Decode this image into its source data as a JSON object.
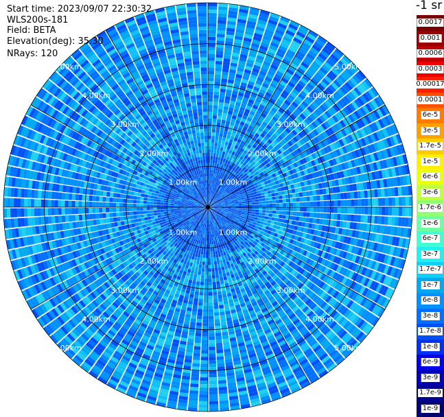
{
  "info": {
    "start_time": "Start time: 2023/09/07 22:30:32",
    "scan_name": "WLS200s-181",
    "field": "Field: BETA",
    "elevation": "Elevation(deg): 35.30",
    "nrays": "NRays: 120"
  },
  "unit_label": "-1 sr",
  "colorbar": {
    "labels": [
      "0.0017",
      "0.001",
      "0.0006",
      "0.0003",
      "0.00017",
      "0.0001",
      "6e-5",
      "3e-5",
      "1.7e-5",
      "1e-5",
      "6e-6",
      "3e-6",
      "1.7e-6",
      "1e-6",
      "6e-7",
      "3e-7",
      "1.7e-7",
      "1e-7",
      "6e-8",
      "3e-8",
      "1.7e-8",
      "1e-8",
      "6e-9",
      "3e-9",
      "1.7e-9",
      "1e-9"
    ],
    "colors": [
      "#780000",
      "#9a0000",
      "#c00000",
      "#ee0000",
      "#ff2000",
      "#ff5000",
      "#ff7a00",
      "#ffa000",
      "#ffcc00",
      "#fff000",
      "#e8ff10",
      "#c0ff40",
      "#90ff70",
      "#70ffa0",
      "#40ffd0",
      "#20f0f0",
      "#10d0f8",
      "#00a8f0",
      "#0090ff",
      "#0070ff",
      "#0050f8",
      "#0030f0",
      "#0000e8",
      "#0000b8",
      "#000090",
      "#000070"
    ]
  },
  "range_rings": {
    "labels": [
      "1.00km",
      "2.00km",
      "3.00km",
      "4.00km",
      "5.00km"
    ]
  },
  "chart_data": {
    "type": "heatmap",
    "title": "",
    "field": "BETA",
    "elevation_deg": 35.3,
    "nrays": 120,
    "range_km_max": 5.0,
    "range_rings_km": [
      1,
      2,
      3,
      4,
      5
    ],
    "colorscale": "log backscatter, 1e-9 to 0.0017 sr-1",
    "typical_values": "mostly 1e-8 to 1.7e-7"
  }
}
